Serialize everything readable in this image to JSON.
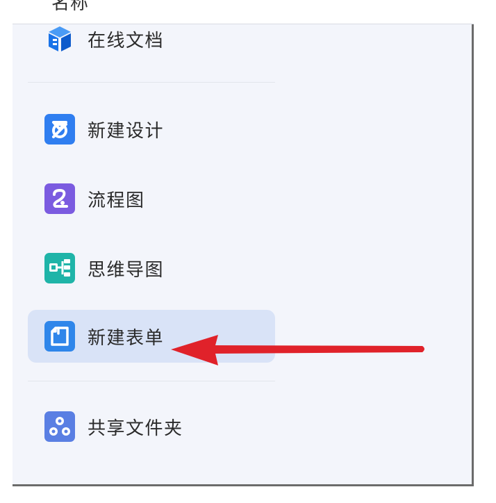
{
  "top_partial_label": "名称",
  "menu": {
    "items": [
      {
        "label": "在线文档",
        "icon": "online-doc-icon",
        "color": "#1a73e8"
      },
      {
        "label": "新建设计",
        "icon": "design-icon",
        "color": "#2f7ef0"
      },
      {
        "label": "流程图",
        "icon": "flowchart-icon",
        "color": "#7b5be0"
      },
      {
        "label": "思维导图",
        "icon": "mindmap-icon",
        "color": "#1fb4a8"
      },
      {
        "label": "新建表单",
        "icon": "form-icon",
        "color": "#2f86ea",
        "selected": true
      },
      {
        "label": "共享文件夹",
        "icon": "shared-folder-icon",
        "color": "#5a7fe3"
      }
    ]
  },
  "colors": {
    "panel_background": "#f3f5fb",
    "selected_background": "#d9e3f7",
    "arrow": "#e0222a"
  }
}
